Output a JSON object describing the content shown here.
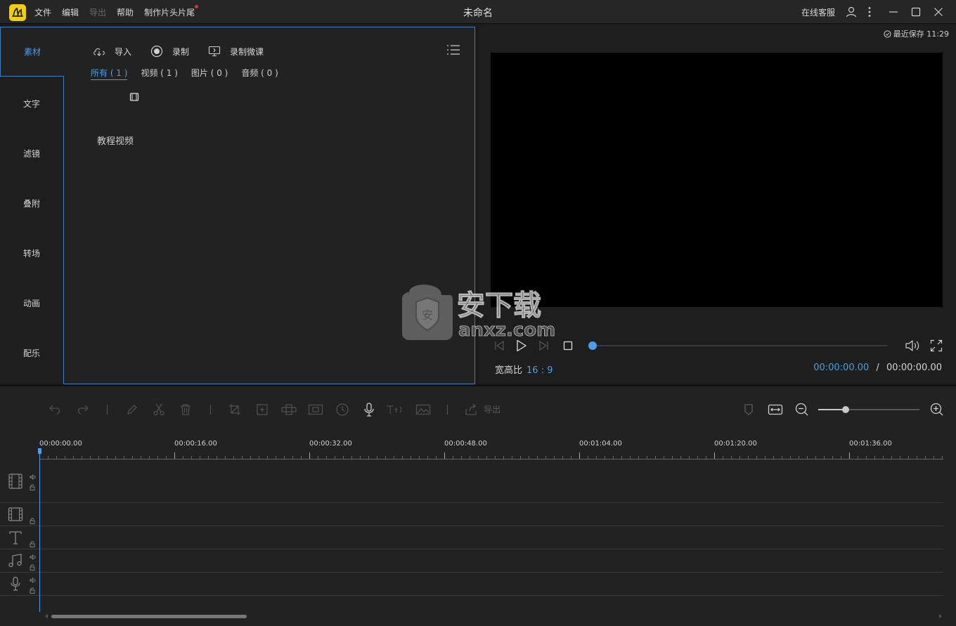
{
  "app": {
    "title": "未命名",
    "menu": [
      "文件",
      "编辑",
      "导出",
      "帮助",
      "制作片头片尾"
    ],
    "menu_disabled_index": 2,
    "online_service": "在线客服",
    "icons": {
      "logo": "app-logo-icon",
      "user": "user-icon",
      "more": "more-vertical-icon",
      "minimize": "minimize-icon",
      "maximize": "maximize-icon",
      "close": "close-icon"
    }
  },
  "leftnav": {
    "items": [
      "素材",
      "文字",
      "滤镜",
      "叠附",
      "转场",
      "动画",
      "配乐"
    ],
    "active_index": 0
  },
  "media": {
    "toolbar": {
      "import": "导入",
      "record": "录制",
      "record_lesson": "录制微课"
    },
    "filters": [
      "所有 ( 1 )",
      "视频 ( 1 )",
      "图片 ( 0 )",
      "音频 ( 0 )"
    ],
    "active_filter": 0,
    "items": [
      {
        "label": "教程视频"
      }
    ]
  },
  "preview": {
    "last_saved": "最近保存 11:29",
    "aspect_label": "宽高比",
    "aspect_value": "16 : 9",
    "current_time": "00:00:00.00",
    "time_sep": "/",
    "total_time": "00:00:00.00",
    "progress": 0
  },
  "timeline": {
    "export_label": "导出",
    "zoom_level": 0.27,
    "ruler_labels": [
      "00:00:00.00",
      "00:00:16.00",
      "00:00:32.00",
      "00:00:48.00",
      "00:01:04.00",
      "00:01:20.00",
      "00:01:36.00"
    ],
    "tracks": [
      "video-track",
      "overlay-track",
      "text-track",
      "music-track",
      "voice-track"
    ]
  },
  "colors": {
    "accent": "#4a9fe8",
    "logo": "#f2cf0a",
    "background": "#1b1b1b",
    "panel": "#222222"
  },
  "watermark": {
    "site": "anxz.com",
    "name": "安下载"
  }
}
